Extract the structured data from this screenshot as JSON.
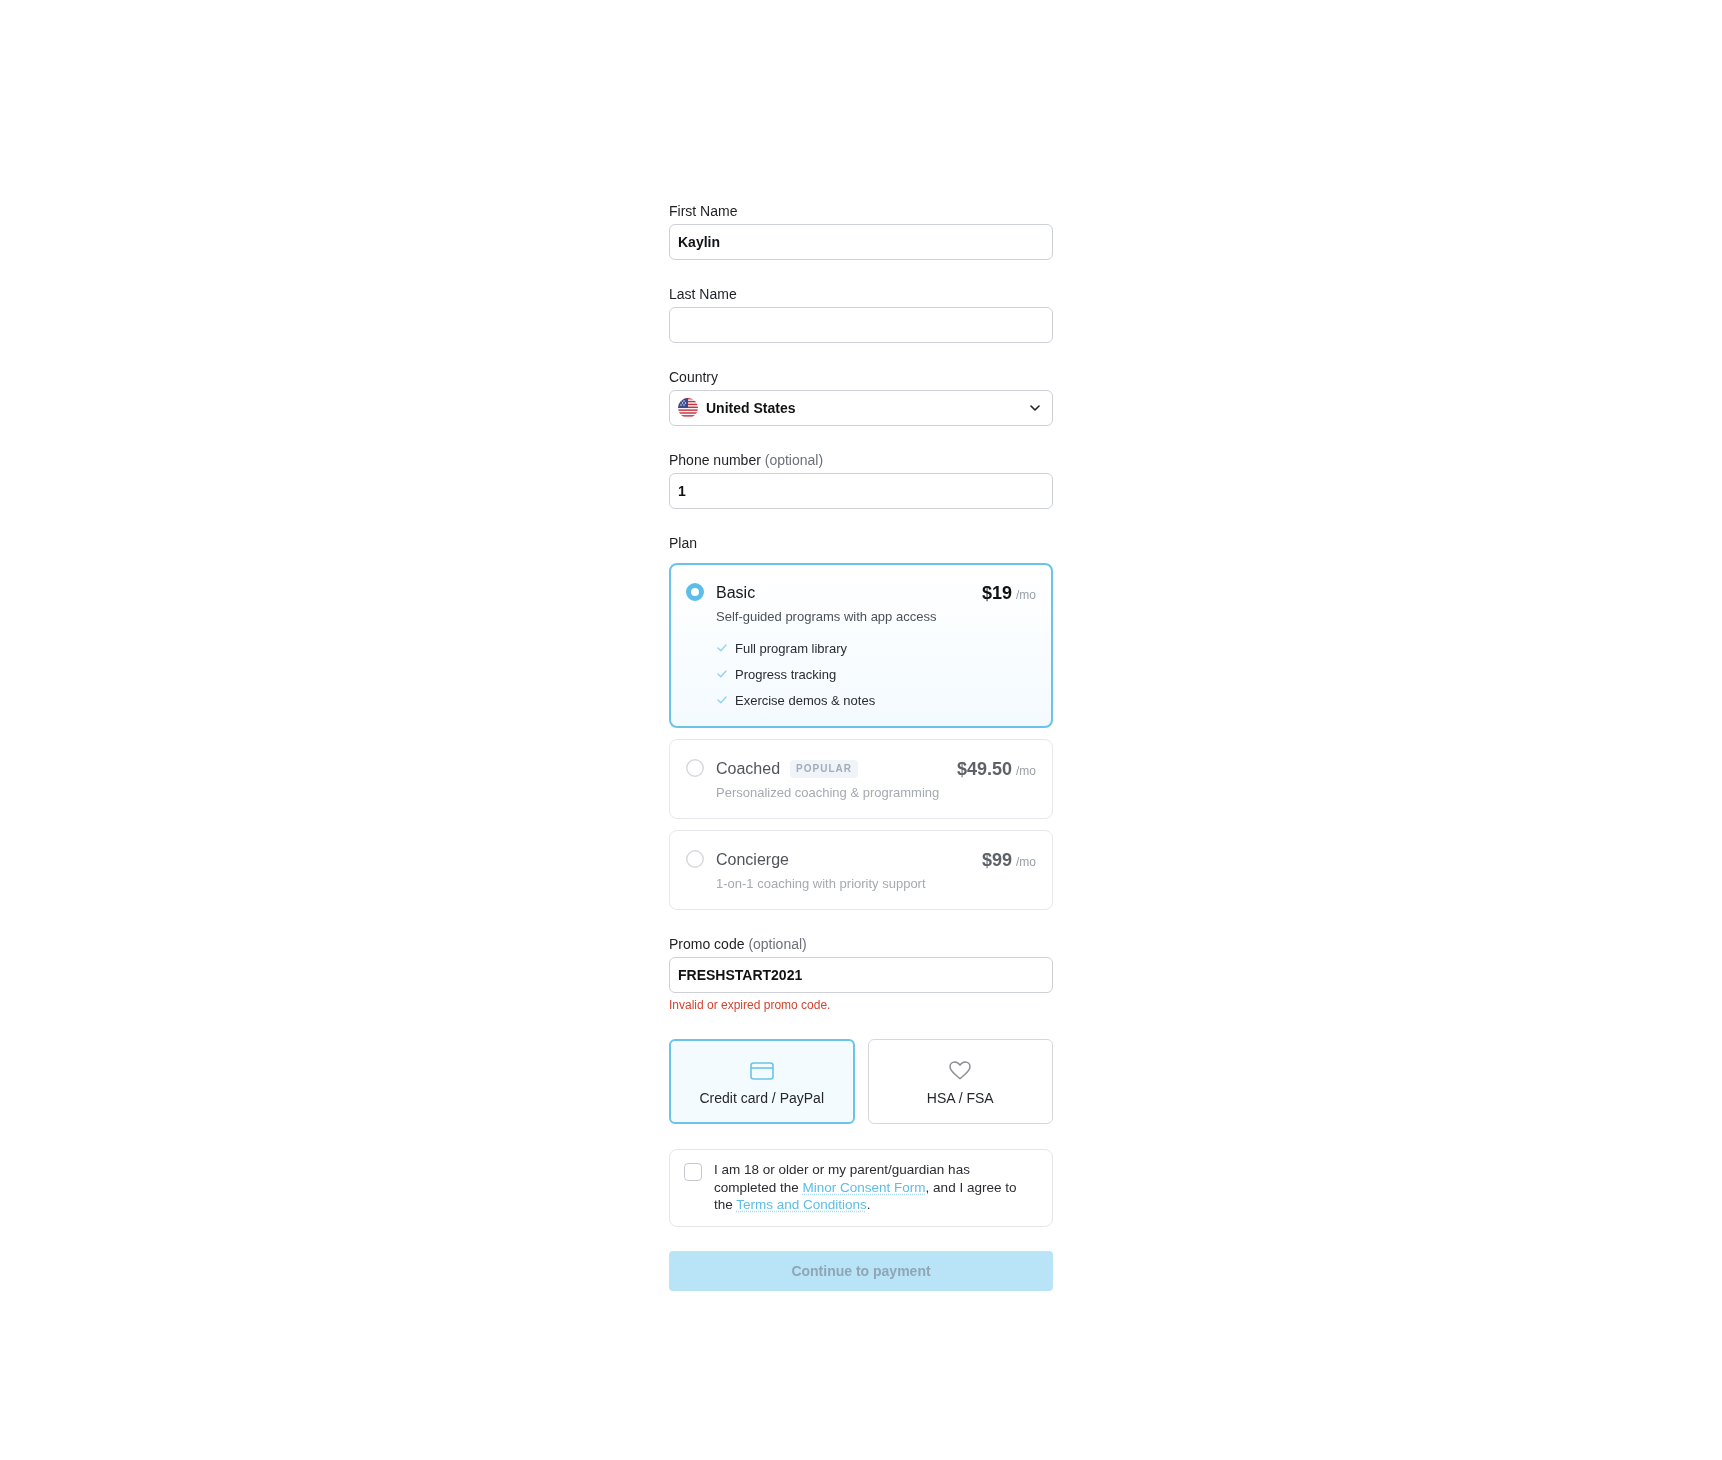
{
  "fields": [
    {
      "kind": "text",
      "label": "First Name",
      "value": "Kaylin"
    },
    {
      "kind": "text",
      "label": "Last Name"
    },
    {
      "kind": "select",
      "label": "Country",
      "value": "United States"
    },
    {
      "kind": "text",
      "label": "Phone number",
      "label_note": "(optional)",
      "value": "1"
    }
  ],
  "plan": {
    "label": "Plan",
    "options": [
      {
        "name": "Basic",
        "price": "$19",
        "period": "/mo",
        "description": "Self-guided programs with app access",
        "features": [
          "Full program library",
          "Progress tracking",
          "Exercise demos & notes"
        ],
        "selected": true
      },
      {
        "name": "Coached",
        "badge": "POPULAR",
        "price": "$49.50",
        "period": "/mo",
        "description": "Personalized coaching & programming",
        "selected": false
      },
      {
        "name": "Concierge",
        "price": "$99",
        "period": "/mo",
        "description": "1-on-1 coaching with priority support",
        "selected": false
      }
    ]
  },
  "promo": {
    "label": "Promo code",
    "label_note": "(optional)",
    "value": "FRESHSTART2021",
    "error": "Invalid or expired promo code."
  },
  "payment_methods": [
    {
      "kind": "card",
      "label": "Credit card / PayPal",
      "selected": true
    },
    {
      "kind": "health",
      "label": "HSA / FSA",
      "selected": false
    }
  ],
  "consent": {
    "checked": false,
    "parts": [
      {
        "kind": "text",
        "text": "I am 18 or older or my parent/guardian has completed the "
      },
      {
        "kind": "link",
        "text": "Minor Consent Form"
      },
      {
        "kind": "text",
        "text": ", and I agree to the "
      },
      {
        "kind": "link",
        "text": "Terms and Conditions"
      },
      {
        "kind": "text",
        "text": "."
      }
    ]
  },
  "submit": {
    "label": "Continue to payment",
    "disabled": true
  }
}
